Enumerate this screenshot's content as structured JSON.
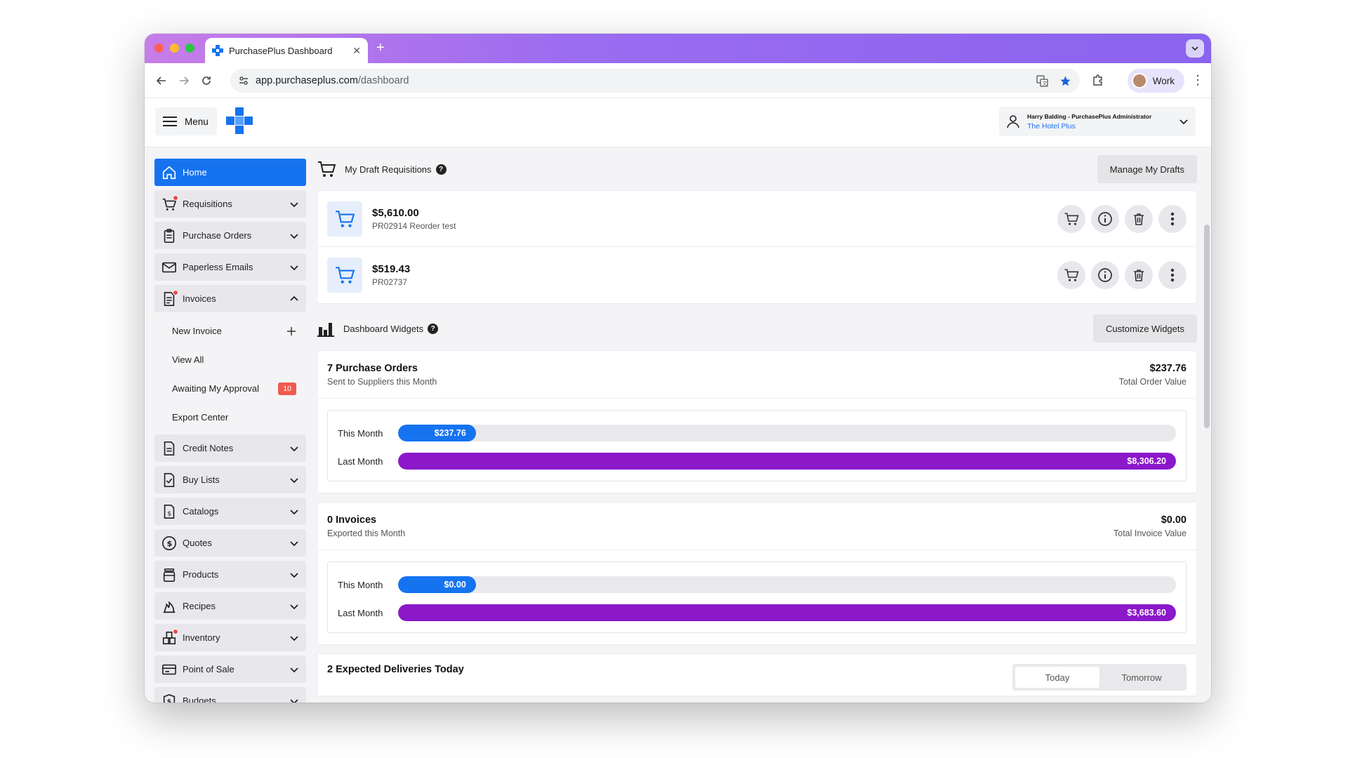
{
  "browser": {
    "tab_title": "PurchasePlus Dashboard",
    "url_host": "app.purchaseplus.com",
    "url_path": "/dashboard",
    "profile_label": "Work"
  },
  "header": {
    "menu_label": "Menu",
    "user_name": "Harry Balding - PurchasePlus Administrator",
    "user_org": "The Hotel Plus"
  },
  "sidebar": {
    "items": [
      {
        "label": "Home",
        "icon": "home-icon",
        "active": true
      },
      {
        "label": "Requisitions",
        "icon": "cart-icon",
        "dot": true
      },
      {
        "label": "Purchase Orders",
        "icon": "clipboard-icon"
      },
      {
        "label": "Paperless Emails",
        "icon": "envelope-icon"
      },
      {
        "label": "Invoices",
        "icon": "invoice-icon",
        "dot": true,
        "expanded": true
      },
      {
        "label": "Credit Notes",
        "icon": "document-icon"
      },
      {
        "label": "Buy Lists",
        "icon": "checklist-icon"
      },
      {
        "label": "Catalogs",
        "icon": "catalog-icon"
      },
      {
        "label": "Quotes",
        "icon": "dollar-circle-icon"
      },
      {
        "label": "Products",
        "icon": "jar-icon"
      },
      {
        "label": "Recipes",
        "icon": "flame-icon"
      },
      {
        "label": "Inventory",
        "icon": "boxes-icon",
        "dot": true
      },
      {
        "label": "Point of Sale",
        "icon": "card-icon"
      },
      {
        "label": "Budgets",
        "icon": "shield-dollar-icon"
      }
    ],
    "invoice_sub": {
      "new_invoice": "New Invoice",
      "view_all": "View All",
      "awaiting": "Awaiting My Approval",
      "awaiting_count": "10",
      "export_center": "Export Center"
    }
  },
  "drafts": {
    "title": "My Draft Requisitions",
    "manage_label": "Manage My Drafts",
    "items": [
      {
        "amount": "$5,610.00",
        "ref": "PR02914 Reorder test"
      },
      {
        "amount": "$519.43",
        "ref": "PR02737"
      }
    ]
  },
  "widgets": {
    "title": "Dashboard Widgets",
    "customize_label": "Customize Widgets",
    "purchase_orders": {
      "title": "7 Purchase Orders",
      "subtitle": "Sent to Suppliers this Month",
      "total": "$237.76",
      "total_label": "Total Order Value",
      "this_month_label": "This Month",
      "this_month_value": "$237.76",
      "this_month_fill": 0.1,
      "last_month_label": "Last Month",
      "last_month_value": "$8,306.20",
      "last_month_fill": 1.0
    },
    "invoices": {
      "title": "0 Invoices",
      "subtitle": "Exported this Month",
      "total": "$0.00",
      "total_label": "Total Invoice Value",
      "this_month_label": "This Month",
      "this_month_value": "$0.00",
      "this_month_fill": 0.1,
      "last_month_label": "Last Month",
      "last_month_value": "$3,683.60",
      "last_month_fill": 1.0
    },
    "deliveries": {
      "title": "2 Expected Deliveries Today",
      "tab_today": "Today",
      "tab_tomorrow": "Tomorrow"
    }
  },
  "colors": {
    "primary": "#1673f0",
    "purple_bar": "#8b18c9",
    "badge": "#ef5b4e"
  }
}
